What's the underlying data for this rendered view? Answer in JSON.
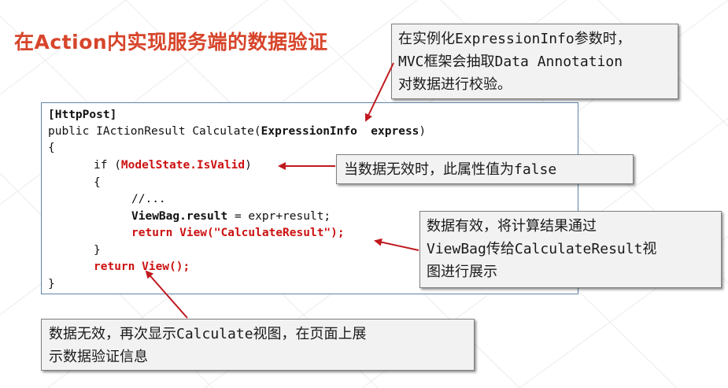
{
  "title": "在Action内实现服务端的数据验证",
  "code": {
    "line1": "[HttpPost]",
    "line2_prefix": "public IActionResult Calculate(",
    "line2_param": "ExpressionInfo  express",
    "line2_suffix": ")",
    "line3": "{",
    "line4_prefix": "if (",
    "line4_cond": "ModelState.IsValid",
    "line4_suffix": ")",
    "line5": "{",
    "line6": "//...",
    "line7_bold": "ViewBag.result",
    "line7_rest": " = expr+result;",
    "line8": "return View(\"CalculateResult\");",
    "line9": "}",
    "line10": "return View();",
    "line11": "}"
  },
  "callouts": {
    "expressioninfo": "在实例化ExpressionInfo参数时，\nMVC框架会抽取Data Annotation\n对数据进行校验。",
    "invalid_false": "当数据无效时，此属性值为false",
    "valid_result": "数据有效，将计算结果通过\nViewBag传给CalculateResult视\n图进行展示",
    "invalid_view": "数据无效，再次显示Calculate视图，在页面上展\n示数据验证信息"
  },
  "colors": {
    "title": "#d7452b",
    "code_red": "#cc1111",
    "arrow": "#c0191f",
    "box_border": "#5f83a8"
  }
}
